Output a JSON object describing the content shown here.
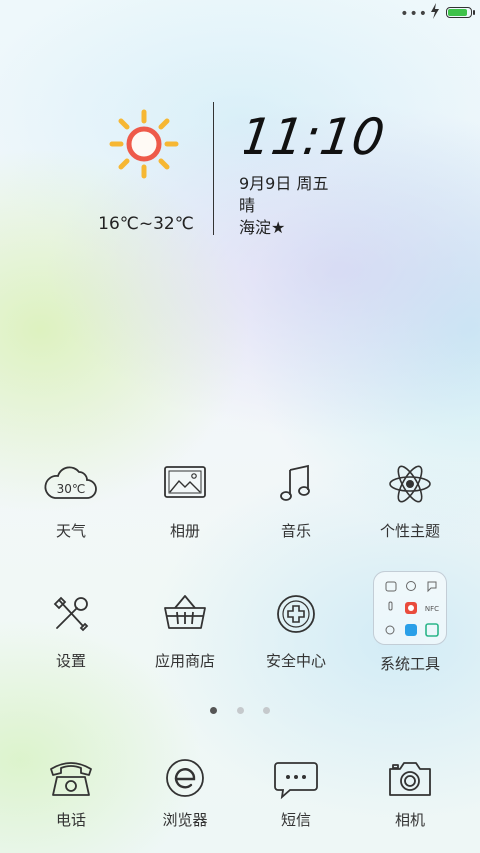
{
  "status_bar": {
    "signal": "•••",
    "battery_level": 0.8,
    "battery_color": "#3ec24a"
  },
  "weather_widget": {
    "icon": "sun-icon",
    "temperature_range": "16℃~32℃",
    "time": "11:10",
    "date": "9月9日 周五",
    "condition": "晴",
    "location": "海淀★"
  },
  "apps": [
    {
      "label": "天气",
      "icon": "weather-cloud-icon",
      "icon_text": "30℃"
    },
    {
      "label": "相册",
      "icon": "gallery-icon"
    },
    {
      "label": "音乐",
      "icon": "music-note-icon"
    },
    {
      "label": "个性主题",
      "icon": "atom-icon"
    },
    {
      "label": "设置",
      "icon": "tools-icon"
    },
    {
      "label": "应用商店",
      "icon": "shopping-basket-icon"
    },
    {
      "label": "安全中心",
      "icon": "shield-plus-icon"
    },
    {
      "label": "系统工具",
      "icon": "folder-icon",
      "folder_text": "NFC"
    }
  ],
  "page_indicator": {
    "count": 3,
    "active": 1
  },
  "dock": [
    {
      "label": "电话",
      "icon": "telephone-icon"
    },
    {
      "label": "浏览器",
      "icon": "browser-icon"
    },
    {
      "label": "短信",
      "icon": "message-icon"
    },
    {
      "label": "相机",
      "icon": "camera-icon"
    }
  ]
}
